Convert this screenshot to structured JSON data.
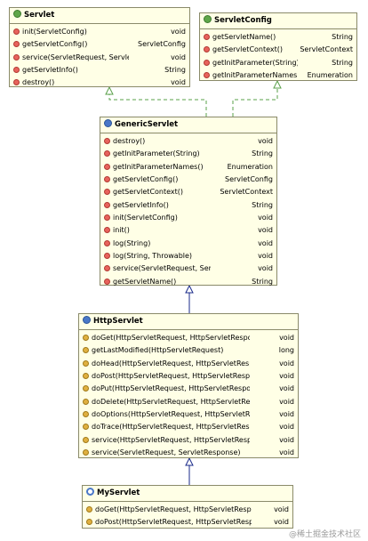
{
  "classes": {
    "servlet": {
      "name": "Servlet",
      "kind": "interface",
      "methods": [
        {
          "name": "init(ServletConfig)",
          "ret": "void"
        },
        {
          "name": "getServletConfig()",
          "ret": "ServletConfig"
        },
        {
          "name": "service(ServletRequest, ServletResponse)",
          "ret": "void"
        },
        {
          "name": "getServletInfo()",
          "ret": "String"
        },
        {
          "name": "destroy()",
          "ret": "void"
        }
      ]
    },
    "servletconfig": {
      "name": "ServletConfig",
      "kind": "interface",
      "methods": [
        {
          "name": "getServletName()",
          "ret": "String"
        },
        {
          "name": "getServletContext()",
          "ret": "ServletContext"
        },
        {
          "name": "getInitParameter(String)",
          "ret": "String"
        },
        {
          "name": "getInitParameterNames()",
          "ret": "Enumeration"
        }
      ]
    },
    "genericservlet": {
      "name": "GenericServlet",
      "kind": "class",
      "methods": [
        {
          "name": "destroy()",
          "ret": "void"
        },
        {
          "name": "getInitParameter(String)",
          "ret": "String"
        },
        {
          "name": "getInitParameterNames()",
          "ret": "Enumeration"
        },
        {
          "name": "getServletConfig()",
          "ret": "ServletConfig"
        },
        {
          "name": "getServletContext()",
          "ret": "ServletContext"
        },
        {
          "name": "getServletInfo()",
          "ret": "String"
        },
        {
          "name": "init(ServletConfig)",
          "ret": "void"
        },
        {
          "name": "init()",
          "ret": "void"
        },
        {
          "name": "log(String)",
          "ret": "void"
        },
        {
          "name": "log(String, Throwable)",
          "ret": "void"
        },
        {
          "name": "service(ServletRequest, ServletResponse)",
          "ret": "void"
        },
        {
          "name": "getServletName()",
          "ret": "String"
        }
      ]
    },
    "httpservlet": {
      "name": "HttpServlet",
      "kind": "class",
      "methods": [
        {
          "name": "doGet(HttpServletRequest, HttpServletResponse)",
          "ret": "void"
        },
        {
          "name": "getLastModified(HttpServletRequest)",
          "ret": "long"
        },
        {
          "name": "doHead(HttpServletRequest, HttpServletResponse)",
          "ret": "void"
        },
        {
          "name": "doPost(HttpServletRequest, HttpServletResponse)",
          "ret": "void"
        },
        {
          "name": "doPut(HttpServletRequest, HttpServletResponse)",
          "ret": "void"
        },
        {
          "name": "doDelete(HttpServletRequest, HttpServletResponse)",
          "ret": "void"
        },
        {
          "name": "doOptions(HttpServletRequest, HttpServletResponse)",
          "ret": "void"
        },
        {
          "name": "doTrace(HttpServletRequest, HttpServletResponse)",
          "ret": "void"
        },
        {
          "name": "service(HttpServletRequest, HttpServletResponse)",
          "ret": "void"
        },
        {
          "name": "service(ServletRequest, ServletResponse)",
          "ret": "void"
        }
      ]
    },
    "myservlet": {
      "name": "MyServlet",
      "kind": "myclass",
      "methods": [
        {
          "name": "doGet(HttpServletRequest, HttpServletResponse)",
          "ret": "void"
        },
        {
          "name": "doPost(HttpServletRequest, HttpServletResponse)",
          "ret": "void"
        }
      ]
    }
  },
  "watermark": "@稀土掘金技术社区",
  "colors": {
    "box_fill": "#ffffe6",
    "box_border": "#8a8a6a",
    "implements_line": "#5aa04a",
    "extends_line": "#1a2a8a"
  }
}
